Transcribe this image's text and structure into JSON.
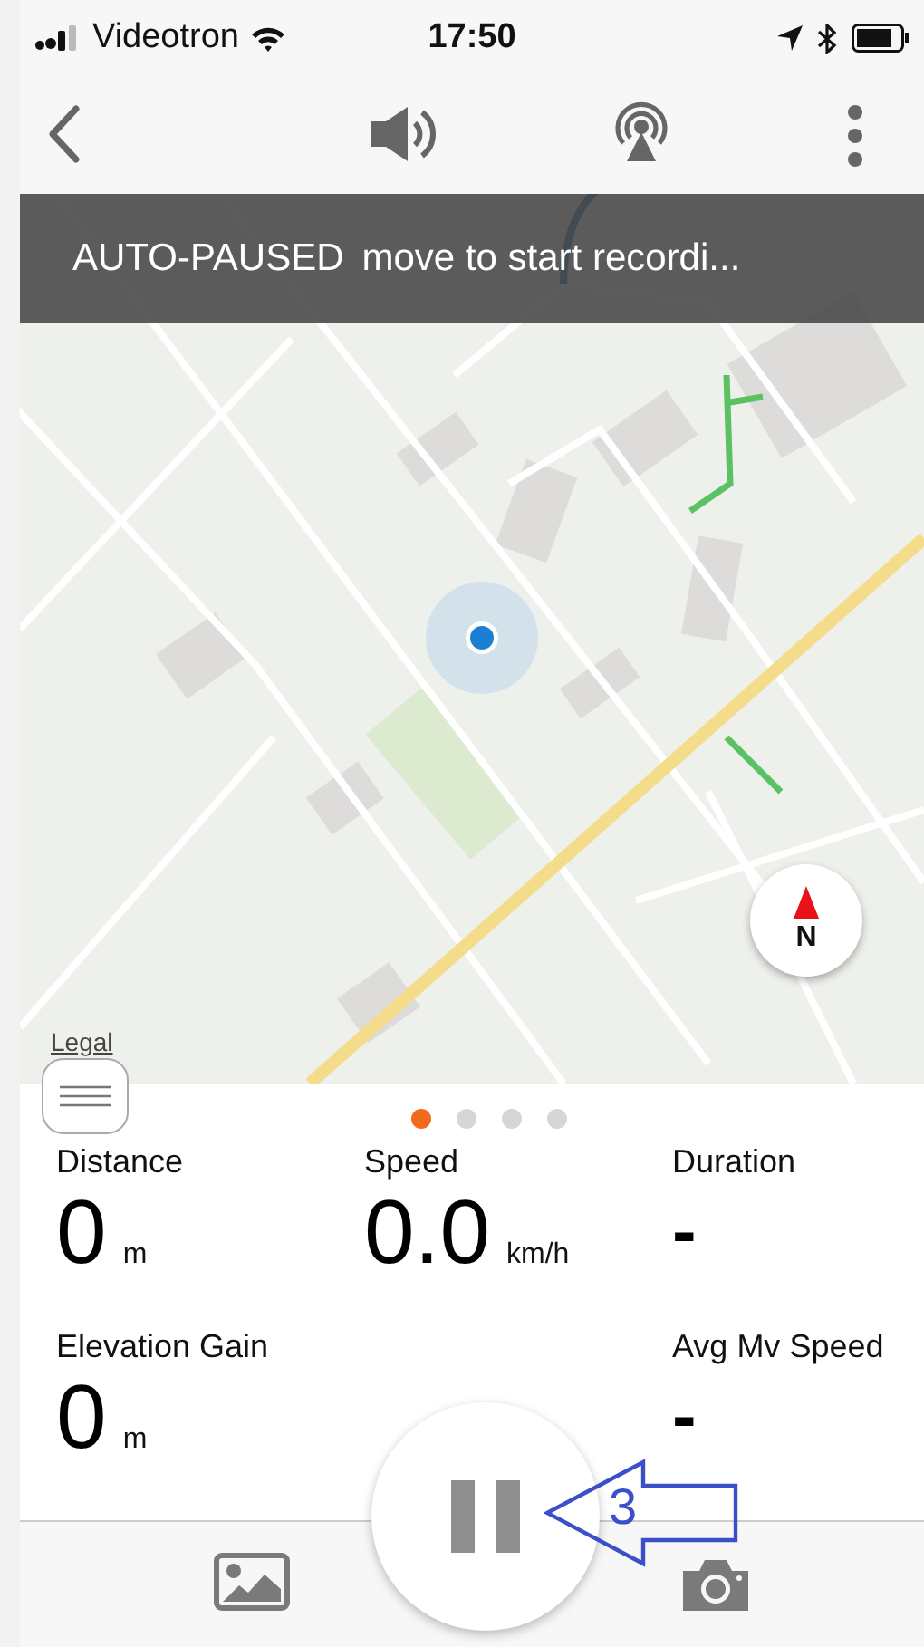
{
  "status_bar": {
    "carrier": "Videotron",
    "time": "17:50"
  },
  "banner": {
    "status": "AUTO-PAUSED",
    "message": "move to start recordi..."
  },
  "map": {
    "legal": "Legal",
    "compass": "N"
  },
  "pages": [
    {
      "selected": true
    },
    {
      "selected": false
    },
    {
      "selected": false
    },
    {
      "selected": false
    }
  ],
  "stats": [
    {
      "kind": "metric",
      "label": "Distance",
      "value": "0",
      "unit": "m"
    },
    {
      "kind": "metric",
      "label": "Speed",
      "value": "0.0",
      "unit": "km/h"
    },
    {
      "kind": "metric",
      "label": "Duration",
      "value": "-"
    },
    {
      "kind": "metric",
      "label": "Elevation Gain",
      "value": "0",
      "unit": "m"
    },
    {
      "kind": "blank"
    },
    {
      "kind": "metric",
      "label": "Avg Mv Speed",
      "value": "-"
    }
  ],
  "annotation": {
    "label": "3"
  }
}
